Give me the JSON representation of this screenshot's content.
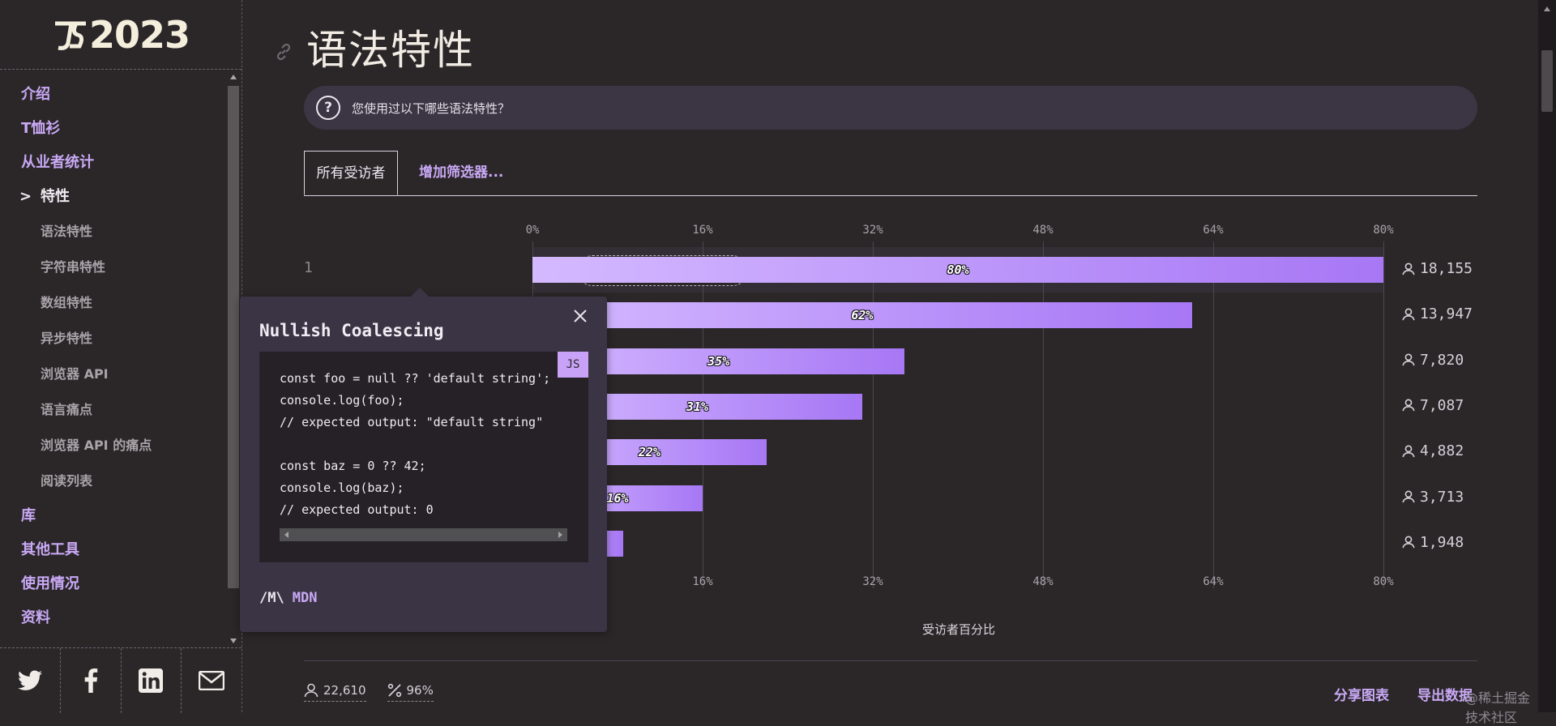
{
  "logo": {
    "year": "2023"
  },
  "nav": {
    "items": [
      {
        "label": "介绍"
      },
      {
        "label": "T恤衫"
      },
      {
        "label": "从业者统计"
      },
      {
        "label": "特性",
        "active": true,
        "caret": ">"
      }
    ],
    "sub_items": [
      {
        "label": "语法特性"
      },
      {
        "label": "字符串特性"
      },
      {
        "label": "数组特性"
      },
      {
        "label": "异步特性"
      },
      {
        "label": "浏览器 API"
      },
      {
        "label": "语言痛点"
      },
      {
        "label": "浏览器 API 的痛点"
      },
      {
        "label": "阅读列表"
      }
    ],
    "after_items": [
      {
        "label": "库"
      },
      {
        "label": "其他工具"
      },
      {
        "label": "使用情况"
      },
      {
        "label": "资料"
      }
    ]
  },
  "social": [
    "twitter-icon",
    "facebook-icon",
    "linkedin-icon",
    "email-icon"
  ],
  "page": {
    "title": "语法特性",
    "question": "您使用过以下哪些语法特性？",
    "question_icon": "?",
    "tab_all": "所有受访者",
    "tab_filter": "增加筛选器..."
  },
  "chart_data": {
    "type": "bar",
    "orientation": "horizontal",
    "x_ticks": [
      "0%",
      "16%",
      "32%",
      "48%",
      "64%",
      "80%"
    ],
    "x_ticks_bottom": [
      "16%",
      "32%",
      "48%",
      "64%",
      "80%"
    ],
    "xlim": [
      0,
      80
    ],
    "xlabel": "受访者百分比",
    "rows": [
      {
        "rank": "1",
        "name": "Nullish Coalescing",
        "percent": 80,
        "label": "80%",
        "count": "18,155"
      },
      {
        "percent": 62,
        "label": "62%",
        "count": "13,947"
      },
      {
        "percent": 35,
        "label": "35%",
        "count": "7,820"
      },
      {
        "percent": 31,
        "label": "31%",
        "count": "7,087"
      },
      {
        "percent": 22,
        "label": "22%",
        "count": "4,882"
      },
      {
        "percent": 16,
        "label": "16%",
        "count": "3,713"
      },
      {
        "percent": 8.5,
        "label": "",
        "count": "1,948"
      }
    ]
  },
  "footer": {
    "respondents": "22,610",
    "percent": "96%",
    "share": "分享图表",
    "export": "导出数据",
    "watermark": "@稀土掘金技术社区"
  },
  "popover": {
    "title": "Nullish Coalescing",
    "badge": "JS",
    "code": "const foo = null ?? 'default string';\nconsole.log(foo);\n// expected output: \"default string\"\n\nconst baz = 0 ?? 42;\nconsole.log(baz);\n// expected output: 0",
    "link_logo": "/M\\",
    "link_label": "MDN"
  },
  "colors": {
    "accent": "#c9a9f5",
    "bar_start": "#d4b9ff",
    "bar_end": "#a777f5",
    "background": "#2b2729"
  }
}
